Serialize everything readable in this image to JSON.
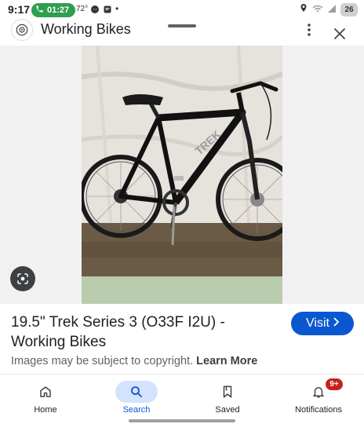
{
  "status_bar": {
    "time": "9:17",
    "call_timer": "01:27",
    "temperature": "72°",
    "battery": "26"
  },
  "header": {
    "site_name": "Working Bikes"
  },
  "result": {
    "title": "19.5\" Trek Series 3 (O33F I2U) - Working Bikes",
    "photo_frame_text": "TREK",
    "visit_label": "Visit",
    "copyright_text": "Images may be subject to copyright.",
    "learn_more": "Learn More"
  },
  "bottom_nav": {
    "items": [
      {
        "label": "Home",
        "icon": "home-icon"
      },
      {
        "label": "Search",
        "icon": "search-icon",
        "active": true
      },
      {
        "label": "Saved",
        "icon": "bookmark-icon"
      },
      {
        "label": "Notifications",
        "icon": "bell-icon",
        "badge": "9+"
      }
    ]
  },
  "colors": {
    "accent": "#0b57d0",
    "active_nav_bg": "#d3e3fd",
    "call_green": "#2e9e4f",
    "badge_red": "#c5221f"
  }
}
